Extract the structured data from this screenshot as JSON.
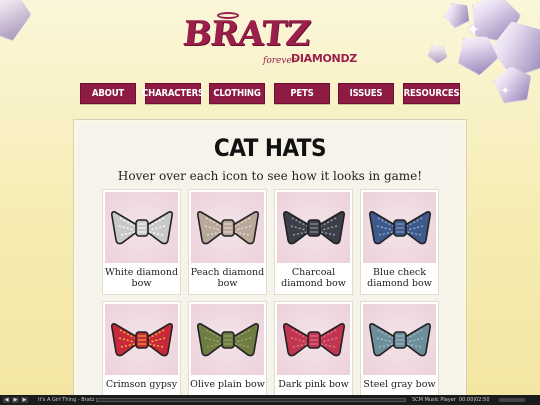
{
  "logo": {
    "main": "BRATZ",
    "forever": "forever",
    "diamondz": "DIAMONDZ"
  },
  "nav": [
    "ABOUT",
    "CHARACTERS",
    "CLOTHING",
    "PETS",
    "ISSUES",
    "RESOURCES"
  ],
  "page": {
    "title": "CAT HATS",
    "subtitle": "Hover over each icon to see how it looks in game!"
  },
  "items": [
    {
      "label": "White diamond bow",
      "color": "#c9c9cc",
      "accent": "#ffffff"
    },
    {
      "label": "Peach diamond bow",
      "color": "#b8a99a",
      "accent": "#e8dccf"
    },
    {
      "label": "Charcoal diamond bow",
      "color": "#3c3f48",
      "accent": "#9aa0ad"
    },
    {
      "label": "Blue check diamond bow",
      "color": "#3d5a8a",
      "accent": "#8fa6cc"
    },
    {
      "label": "Crimson gypsy",
      "color": "#c8283c",
      "accent": "#f2c12e"
    },
    {
      "label": "Olive plain bow",
      "color": "#6f7d45",
      "accent": "#9aa667"
    },
    {
      "label": "Dark pink bow",
      "color": "#c23550",
      "accent": "#e07a8d"
    },
    {
      "label": "Steel gray bow",
      "color": "#6c8e9a",
      "accent": "#a7c0c8"
    }
  ],
  "player": {
    "track": "It's A Girl Thing - Bratz",
    "app": "SCM Music Player",
    "time": "00:00|02:50",
    "progress": 0.0
  }
}
